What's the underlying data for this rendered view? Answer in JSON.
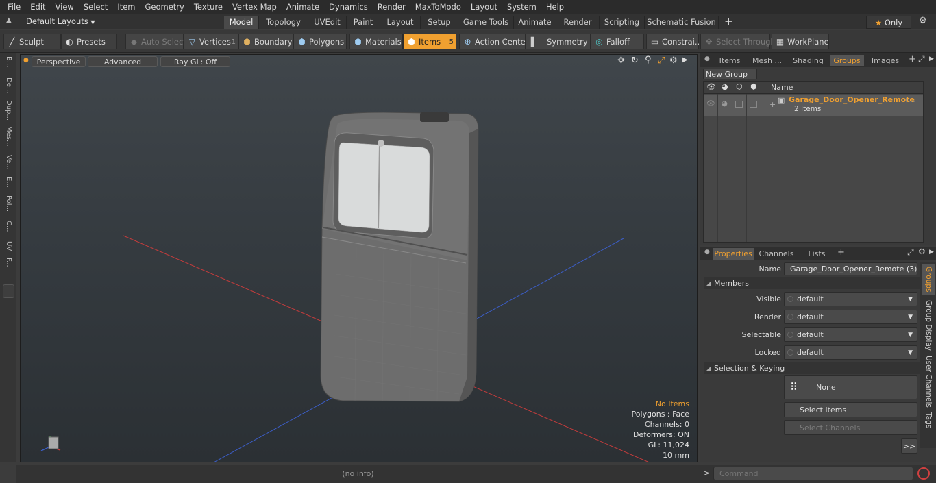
{
  "menu": [
    "File",
    "Edit",
    "View",
    "Select",
    "Item",
    "Geometry",
    "Texture",
    "Vertex Map",
    "Animate",
    "Dynamics",
    "Render",
    "MaxToModo",
    "Layout",
    "System",
    "Help"
  ],
  "layouts": {
    "selector": "Default Layouts",
    "tabs": [
      "Model",
      "Topology",
      "UVEdit",
      "Paint",
      "Layout",
      "Setup",
      "Game Tools",
      "Animate",
      "Render",
      "Scripting",
      "Schematic Fusion"
    ],
    "active_tab": "Model",
    "only": "Only"
  },
  "toolbar": {
    "sculpt": "Sculpt",
    "presets": "Presets",
    "auto_select": "Auto Select",
    "vertices": "Vertices",
    "vertices_count": "1",
    "boundary": "Boundary",
    "polygons": "Polygons",
    "materials": "Materials",
    "items": "Items",
    "items_count": "5",
    "action_center": "Action Center",
    "symmetry": "Symmetry",
    "falloff": "Falloff",
    "constraints": "Constrai...",
    "select_through": "Select Through",
    "workplane": "WorkPlane"
  },
  "left_tabs": [
    "B...",
    "De...",
    "Dup...",
    "Mes...",
    "Ve...",
    "E...",
    "Pol...",
    "C...",
    "UV",
    "F..."
  ],
  "viewport": {
    "perspective": "Perspective",
    "advanced": "Advanced",
    "raygl": "Ray GL: Off",
    "stats": {
      "items": "No Items",
      "polygons": "Polygons : Face",
      "channels": "Channels: 0",
      "deformers": "Deformers: ON",
      "gl": "GL: 11,024",
      "scale": "10 mm"
    },
    "colors": {
      "x_axis": "#c43c3c",
      "z_axis": "#3c5ec8",
      "highlight": "#f0a030"
    }
  },
  "groups_panel": {
    "tabs": [
      "Items",
      "Mesh ...",
      "Shading",
      "Groups",
      "Images"
    ],
    "active_tab": "Groups",
    "new_group": "New Group",
    "col_name": "Name",
    "group_name": "Garage_Door_Opener_Remote",
    "group_suffix": "(...",
    "group_count": "2 Items"
  },
  "properties_panel": {
    "tabs": [
      "Properties",
      "Channels",
      "Lists"
    ],
    "active_tab": "Properties",
    "name_label": "Name",
    "name_value": "Garage_Door_Opener_Remote (3)",
    "members": "Members",
    "visible_label": "Visible",
    "visible_value": "default",
    "render_label": "Render",
    "render_value": "default",
    "selectable_label": "Selectable",
    "selectable_value": "default",
    "locked_label": "Locked",
    "locked_value": "default",
    "selection_keying": "Selection & Keying",
    "none": "None",
    "select_items": "Select Items",
    "select_channels": "Select Channels",
    "more": ">>",
    "side_tabs": [
      "Groups",
      "Group Display",
      "User Channels",
      "Tags"
    ]
  },
  "statusbar": {
    "info": "(no info)",
    "command_placeholder": "Command"
  }
}
